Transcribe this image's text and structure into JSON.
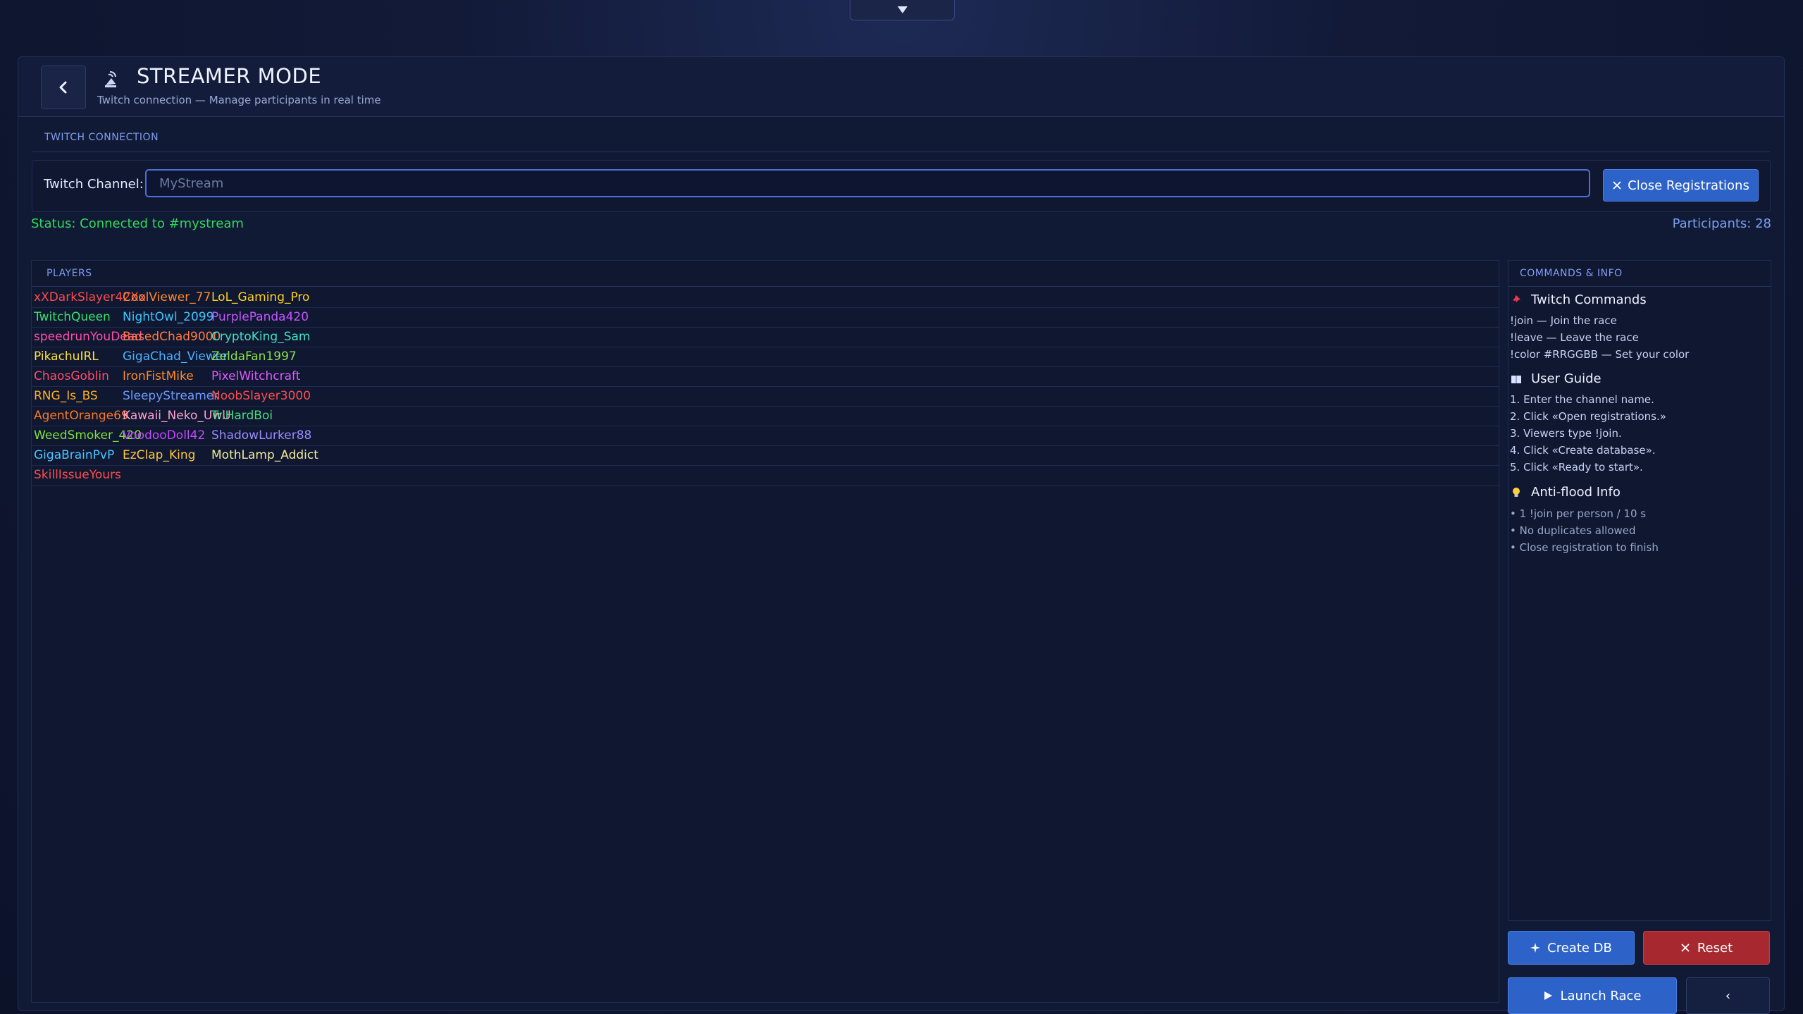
{
  "header": {
    "title": "STREAMER MODE",
    "subtitle": "Twitch connection — Manage participants in real time"
  },
  "connection": {
    "section_label": "TWITCH CONNECTION",
    "channel_label": "Twitch Channel:",
    "channel_placeholder": "MyStream",
    "channel_value": "",
    "close_button": "Close Registrations",
    "status": "Status: Connected to #mystream",
    "participants": "Participants: 28"
  },
  "players": {
    "section_label": "PLAYERS",
    "rows": [
      [
        {
          "name": "xXDarkSlayer42Xx",
          "color": "#ff4d4d"
        },
        {
          "name": "CoolViewer_77",
          "color": "#ff8a2a"
        },
        {
          "name": "LoL_Gaming_Pro",
          "color": "#ffd21f"
        }
      ],
      [
        {
          "name": "TwitchQueen",
          "color": "#3ae06a"
        },
        {
          "name": "NightOwl_2099",
          "color": "#3cc6ff"
        },
        {
          "name": "PurplePanda420",
          "color": "#c455ff"
        }
      ],
      [
        {
          "name": "speedrunYouDead",
          "color": "#ff4fa3"
        },
        {
          "name": "BasedChad9000",
          "color": "#ff7a3d"
        },
        {
          "name": "CryptoKing_Sam",
          "color": "#3ee0c4"
        }
      ],
      [
        {
          "name": "PikachuIRL",
          "color": "#ffe13a"
        },
        {
          "name": "GigaChad_Viewer",
          "color": "#4ab3ff"
        },
        {
          "name": "ZeldaFan1997",
          "color": "#8ce04a"
        }
      ],
      [
        {
          "name": "ChaosGoblin",
          "color": "#ff4d6a"
        },
        {
          "name": "IronFistMike",
          "color": "#ff8c2e"
        },
        {
          "name": "PixelWitchcraft",
          "color": "#e05aff"
        }
      ],
      [
        {
          "name": "RNG_Is_BS",
          "color": "#ffb020"
        },
        {
          "name": "SleepyStreamer",
          "color": "#6f9bff"
        },
        {
          "name": "NoobSlayer3000",
          "color": "#ff4d4d"
        }
      ],
      [
        {
          "name": "AgentOrange69",
          "color": "#ff7a1f"
        },
        {
          "name": "Kawaii_Neko_UwU",
          "color": "#ff9fd0"
        },
        {
          "name": "TriHardBoi",
          "color": "#3ee07a"
        }
      ],
      [
        {
          "name": "WeedSmoker_420",
          "color": "#7fe03a"
        },
        {
          "name": "VoodooDoll42",
          "color": "#c04aff"
        },
        {
          "name": "ShadowLurker88",
          "color": "#9a8cff"
        }
      ],
      [
        {
          "name": "GigaBrainPvP",
          "color": "#4ac6ff"
        },
        {
          "name": "EzClap_King",
          "color": "#ffc640"
        },
        {
          "name": "MothLamp_Addict",
          "color": "#f3ec9a"
        }
      ],
      [
        {
          "name": "SkillIssueYours",
          "color": "#ff4d4d"
        }
      ]
    ]
  },
  "info": {
    "section_label": "COMMANDS & INFO",
    "commands_title": "Twitch Commands",
    "commands": [
      "!join — Join the race",
      "!leave — Leave the race",
      "!color #RRGGBB — Set your color"
    ],
    "guide_title": "User Guide",
    "guide": [
      "1. Enter the channel name.",
      "2. Click «Open registrations.»",
      "3. Viewers type !join.",
      "4. Click «Create database».",
      "5. Click «Ready to start»."
    ],
    "antiflood_title": "Anti-flood Info",
    "antiflood": [
      "• 1 !join per person / 10 s",
      "• No duplicates allowed",
      "• Close registration to finish"
    ]
  },
  "actions": {
    "create_db": "Create DB",
    "reset": "Reset",
    "launch": "Launch Race",
    "back": "‹"
  },
  "colors": {
    "accent": "#2d63c8",
    "danger": "#a8282f",
    "status_ok": "#31d95a",
    "background": "#111a35"
  }
}
